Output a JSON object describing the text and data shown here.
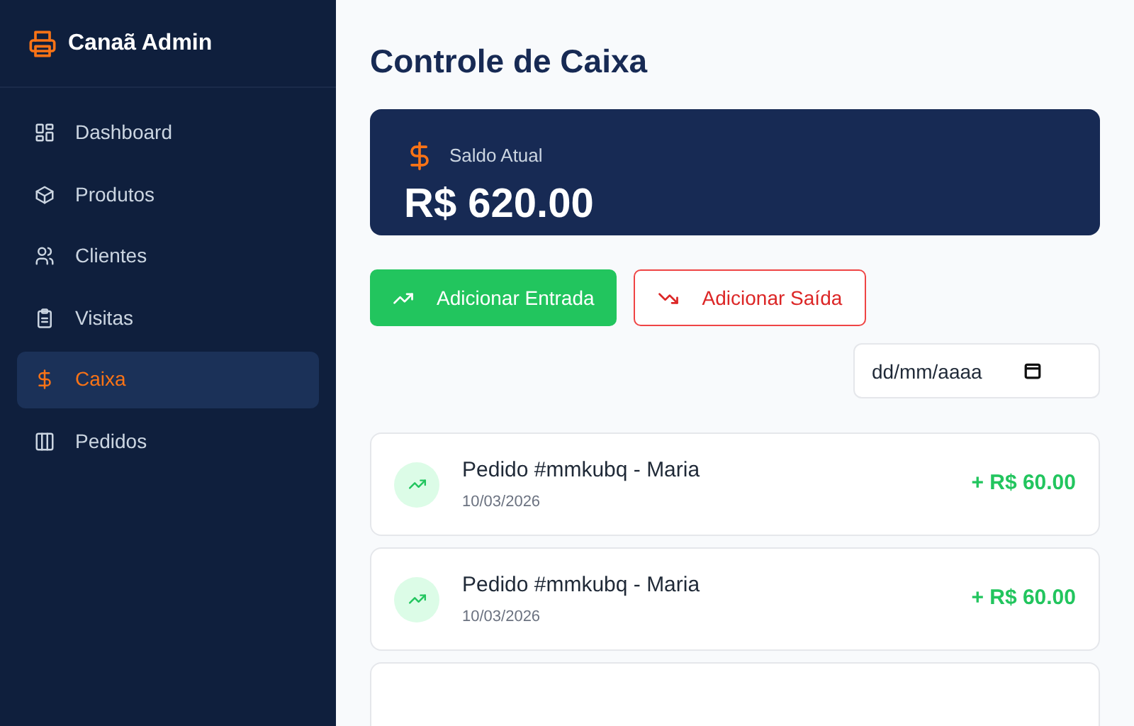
{
  "brand": {
    "name": "Canaã Admin"
  },
  "sidebar": {
    "items": [
      {
        "label": "Dashboard",
        "kind": "grid",
        "selected": false
      },
      {
        "label": "Produtos",
        "kind": "box",
        "selected": false
      },
      {
        "label": "Clientes",
        "kind": "users",
        "selected": false
      },
      {
        "label": "Visitas",
        "kind": "clipboard",
        "selected": false
      },
      {
        "label": "Caixa",
        "kind": "dollar",
        "selected": true
      },
      {
        "label": "Pedidos",
        "kind": "columns",
        "selected": false
      }
    ]
  },
  "page_title": "Controle de Caixa",
  "balance": {
    "label": "Saldo Atual",
    "value": "R$ 620.00"
  },
  "actions": [
    {
      "label": "Adicionar Entrada",
      "kind": "in"
    },
    {
      "label": "Adicionar Saída",
      "kind": "out"
    }
  ],
  "date_filter": {
    "placeholder": "dd/mm/aaaa"
  },
  "transactions": [
    {
      "kind": "in",
      "title": "Pedido #mmkubq - Maria",
      "date": "10/03/2026",
      "amount": "+ R$ 60.00"
    },
    {
      "kind": "in",
      "title": "Pedido #mmkubq - Maria",
      "date": "10/03/2026",
      "amount": "+ R$ 60.00"
    },
    {
      "kind": "partial"
    }
  ]
}
